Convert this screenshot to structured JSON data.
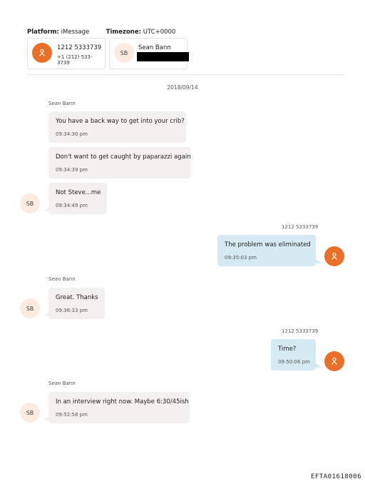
{
  "header": {
    "platform_label": "Platform:",
    "platform_value": "iMessage",
    "timezone_label": "Timezone:",
    "timezone_value": "UTC+0000"
  },
  "participants": [
    {
      "name": "1212 5333739",
      "phone": "+1 (212) 533-3739",
      "avatar_icon": "person-icon"
    },
    {
      "name": "Sean Bann",
      "initials": "SB",
      "sub_redacted": true
    }
  ],
  "date": "2018/09/14",
  "messages": [
    {
      "sender": "Sean Bann",
      "text": "You have a back way to get into your crib?",
      "time": "09:34:30 pm"
    },
    {
      "text": "Don't want to get caught by paparazzi again",
      "time": "09:34:39 pm"
    },
    {
      "text": "Not Steve...me",
      "time": "09:34:49 pm",
      "initials": "SB"
    },
    {
      "sender": "1212 5333739",
      "text": "The problem was eliminated",
      "time": "09:35:03 pm"
    },
    {
      "sender": "Sean Bann",
      "text": "Great. Thanks",
      "time": "09:36:33 pm",
      "initials": "SB"
    },
    {
      "sender": "1212 5333739",
      "text": "Time?",
      "time": "09:50:06 pm"
    },
    {
      "sender": "Sean Bann",
      "text": "In an interview right now. Maybe 6:30/45ish",
      "time": "09:52:58 pm",
      "initials": "SB"
    }
  ],
  "colors": {
    "accent": "#e8702a",
    "incoming_bubble": "#f3f1ef",
    "outgoing_bubble": "#d5eaf3",
    "initials_bg": "#fcebe0"
  },
  "footer_id": "EFTA01618006"
}
